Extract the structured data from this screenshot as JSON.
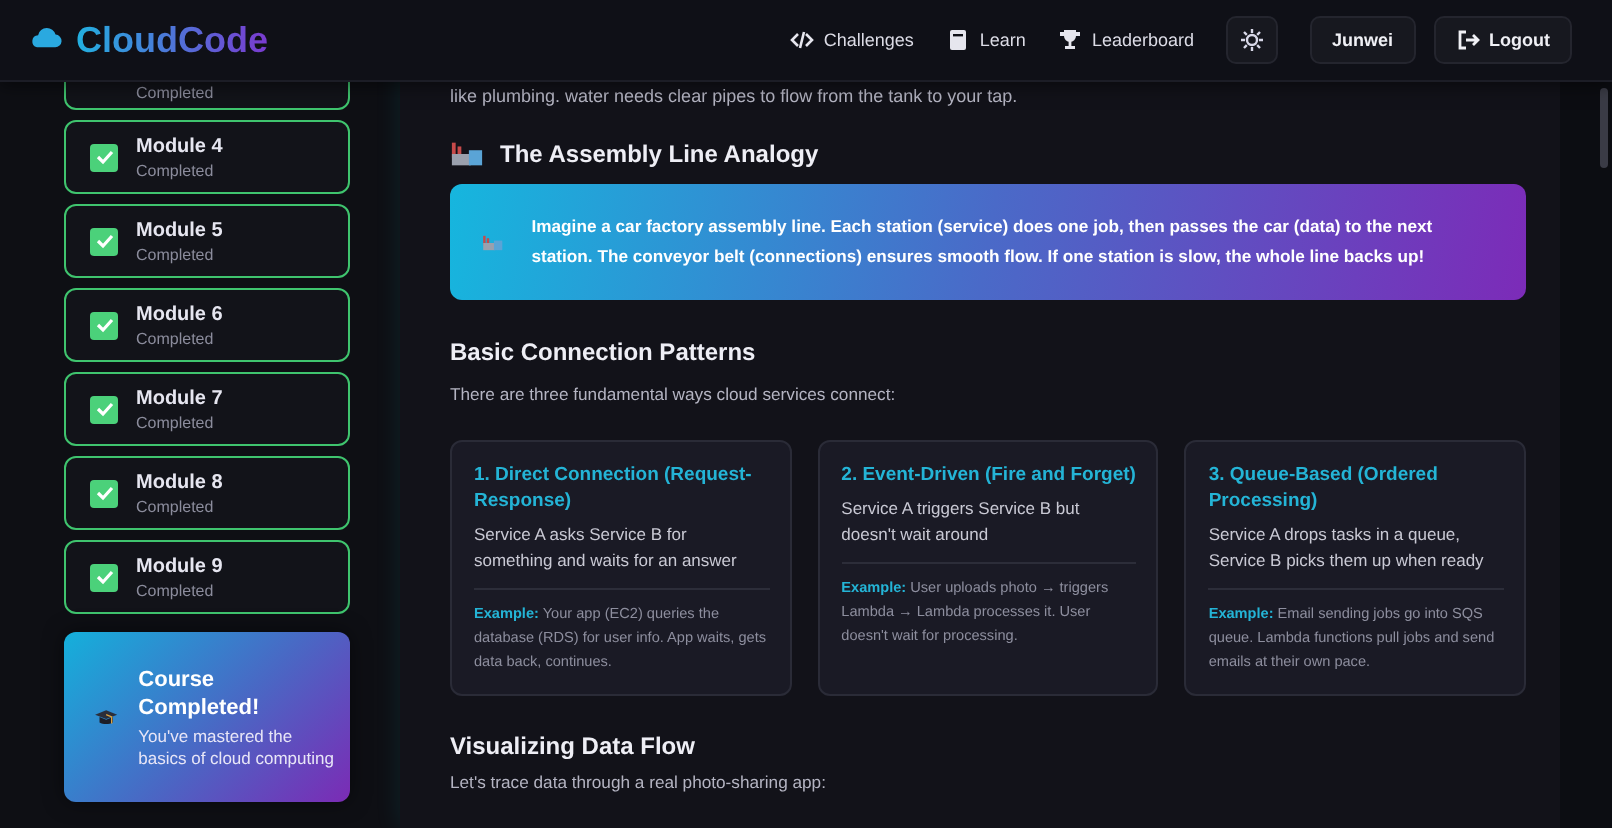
{
  "header": {
    "logo": "CloudCode",
    "nav": [
      {
        "label": "Challenges"
      },
      {
        "label": "Learn"
      },
      {
        "label": "Leaderboard"
      }
    ],
    "user": "Junwei",
    "logout": "Logout"
  },
  "sidebar": {
    "modules": [
      {
        "status": "Completed",
        "completed": true
      },
      {
        "title": "Module 4",
        "status": "Completed",
        "completed": true
      },
      {
        "title": "Module 5",
        "status": "Completed",
        "completed": true
      },
      {
        "title": "Module 6",
        "status": "Completed",
        "completed": true
      },
      {
        "title": "Module 7",
        "status": "Completed",
        "completed": true
      },
      {
        "title": "Module 8",
        "status": "Completed",
        "completed": true
      },
      {
        "title": "Module 9",
        "status": "Completed",
        "completed": true
      }
    ],
    "course_card": {
      "title": "Course Completed!",
      "text": "You've mastered the basics of cloud computing"
    }
  },
  "content": {
    "intro_tail": "like plumbing. water needs clear pipes to flow from the tank to your tap.",
    "analogy": {
      "heading": "The Assembly Line Analogy",
      "text": "Imagine a car factory assembly line. Each station (service) does one job, then passes the car (data) to the next station. The conveyor belt (connections) ensures smooth flow. If one station is slow, the whole line backs up!"
    },
    "patterns": {
      "heading": "Basic Connection Patterns",
      "intro": "There are three fundamental ways cloud services connect:",
      "cards": [
        {
          "title": "1. Direct Connection (Request-Response)",
          "text": "Service A asks Service B for something and waits for an answer",
          "example": "**Example:** Your app (EC2) queries the database (RDS) for user info. App waits, gets data back, continues."
        },
        {
          "title": "2. Event-Driven (Fire and Forget)",
          "text": "Service A triggers Service B but doesn't wait around",
          "example": "**Example:** User uploads photo → triggers Lambda → Lambda processes it. User doesn't wait for processing."
        },
        {
          "title": "3. Queue-Based (Ordered Processing)",
          "text": "Service A drops tasks in a queue, Service B picks them up when ready",
          "example": "**Example:** Email sending jobs go into SQS queue. Lambda functions pull jobs and send emails at their own pace."
        }
      ]
    },
    "flow": {
      "heading": "Visualizing Data Flow",
      "intro": "Let's trace data through a real photo-sharing app:"
    }
  }
}
